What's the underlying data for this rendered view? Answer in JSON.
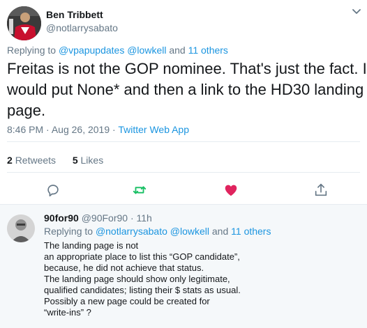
{
  "main_tweet": {
    "author_name": "Ben Tribbett",
    "author_handle": "@notlarrysabato",
    "replying_prefix": "Replying to",
    "replying_mentions": [
      "@vpapupdates",
      "@lowkell"
    ],
    "replying_and": "and",
    "replying_others": "11 others",
    "text_lines": [
      "Freitas is not the GOP nominee.  That's just the fact.  I",
      "would put None* and then a link to the HD30 landing",
      "page."
    ],
    "time": "8:46 PM",
    "date": "Aug 26, 2019",
    "source": "Twitter Web App",
    "retweets_count": "2",
    "retweets_label": "Retweets",
    "likes_count": "5",
    "likes_label": "Likes"
  },
  "actions": [
    "reply-icon",
    "retweet-icon",
    "like-icon",
    "share-icon"
  ],
  "reply_tweet": {
    "author_name": "90for90",
    "author_handle": "@90For90",
    "separator": "·",
    "age": "11h",
    "replying_prefix": "Replying to",
    "replying_mentions": [
      "@notlarrysabato",
      "@lowkell"
    ],
    "replying_and": "and",
    "replying_others": "11 others",
    "text_lines": [
      "The landing page is not",
      "an appropriate place to list this “GOP candidate”,",
      "because, he did not achieve that status.",
      "The landing page should show only legitimate,",
      "qualified candidates; listing their $ stats as usual.",
      "Possibly a new page could be created for",
      "“write-ins” ?"
    ]
  },
  "colors": {
    "link": "#1b95e0",
    "muted": "#657786",
    "retweet_green": "#17bf63",
    "like_red": "#e0245e",
    "reply_background": "#f5f8fa"
  }
}
